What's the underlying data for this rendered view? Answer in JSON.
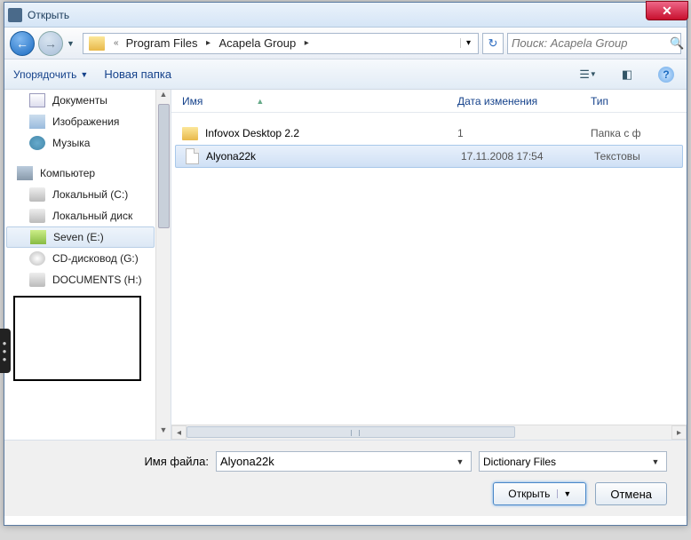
{
  "window": {
    "title": "Открыть"
  },
  "nav": {
    "crumb1": "Program Files",
    "crumb2": "Acapela Group",
    "search_placeholder": "Поиск: Acapela Group"
  },
  "toolbar": {
    "organize": "Упорядочить",
    "newfolder": "Новая папка"
  },
  "sidebar": {
    "libs": [
      {
        "label": "Документы",
        "icon": "icn-docs"
      },
      {
        "label": "Изображения",
        "icon": "icn-img"
      },
      {
        "label": "Музыка",
        "icon": "icn-music"
      }
    ],
    "computer_label": "Компьютер",
    "drives": [
      {
        "label": "Локальный (C:)",
        "icon": "icn-drive",
        "selected": false
      },
      {
        "label": "Локальный диск",
        "icon": "icn-drive",
        "selected": false
      },
      {
        "label": "Seven (E:)",
        "icon": "icn-seven",
        "selected": true
      },
      {
        "label": "CD-дисковод (G:)",
        "icon": "icn-cd",
        "selected": false
      },
      {
        "label": "DOCUMENTS (H:)",
        "icon": "icn-drive",
        "selected": false
      }
    ]
  },
  "columns": {
    "name": "Имя",
    "date": "Дата изменения",
    "type": "Тип"
  },
  "files": [
    {
      "name": "Infovox Desktop 2.2",
      "date": "1",
      "type": "Папка с ф",
      "kind": "folder",
      "selected": false
    },
    {
      "name": "Alyona22k",
      "date": "17.11.2008 17:54",
      "type": "Текстовы",
      "kind": "file",
      "selected": true
    }
  ],
  "bottom": {
    "filename_label": "Имя файла:",
    "filename_value": "Alyona22k",
    "filter_value": "Dictionary Files",
    "open": "Открыть",
    "cancel": "Отмена"
  }
}
